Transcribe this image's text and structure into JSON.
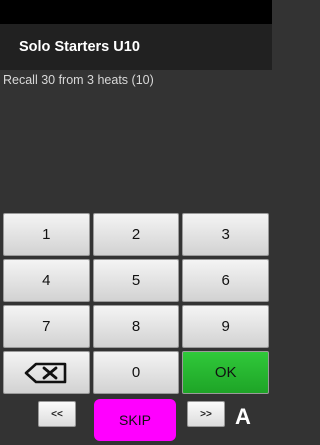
{
  "title": "Solo Starters U10",
  "message": "Recall 30 from 3 heats (10)",
  "keys": [
    "1",
    "2",
    "3",
    "4",
    "5",
    "6",
    "7",
    "8",
    "9",
    "0",
    "OK"
  ],
  "backspace_icon": "backspace-icon",
  "nav": {
    "prev": "<<",
    "skip": "SKIP",
    "next": ">>",
    "marker": "A"
  },
  "colors": {
    "ok": "#22b32c",
    "skip": "#ff00ff"
  }
}
